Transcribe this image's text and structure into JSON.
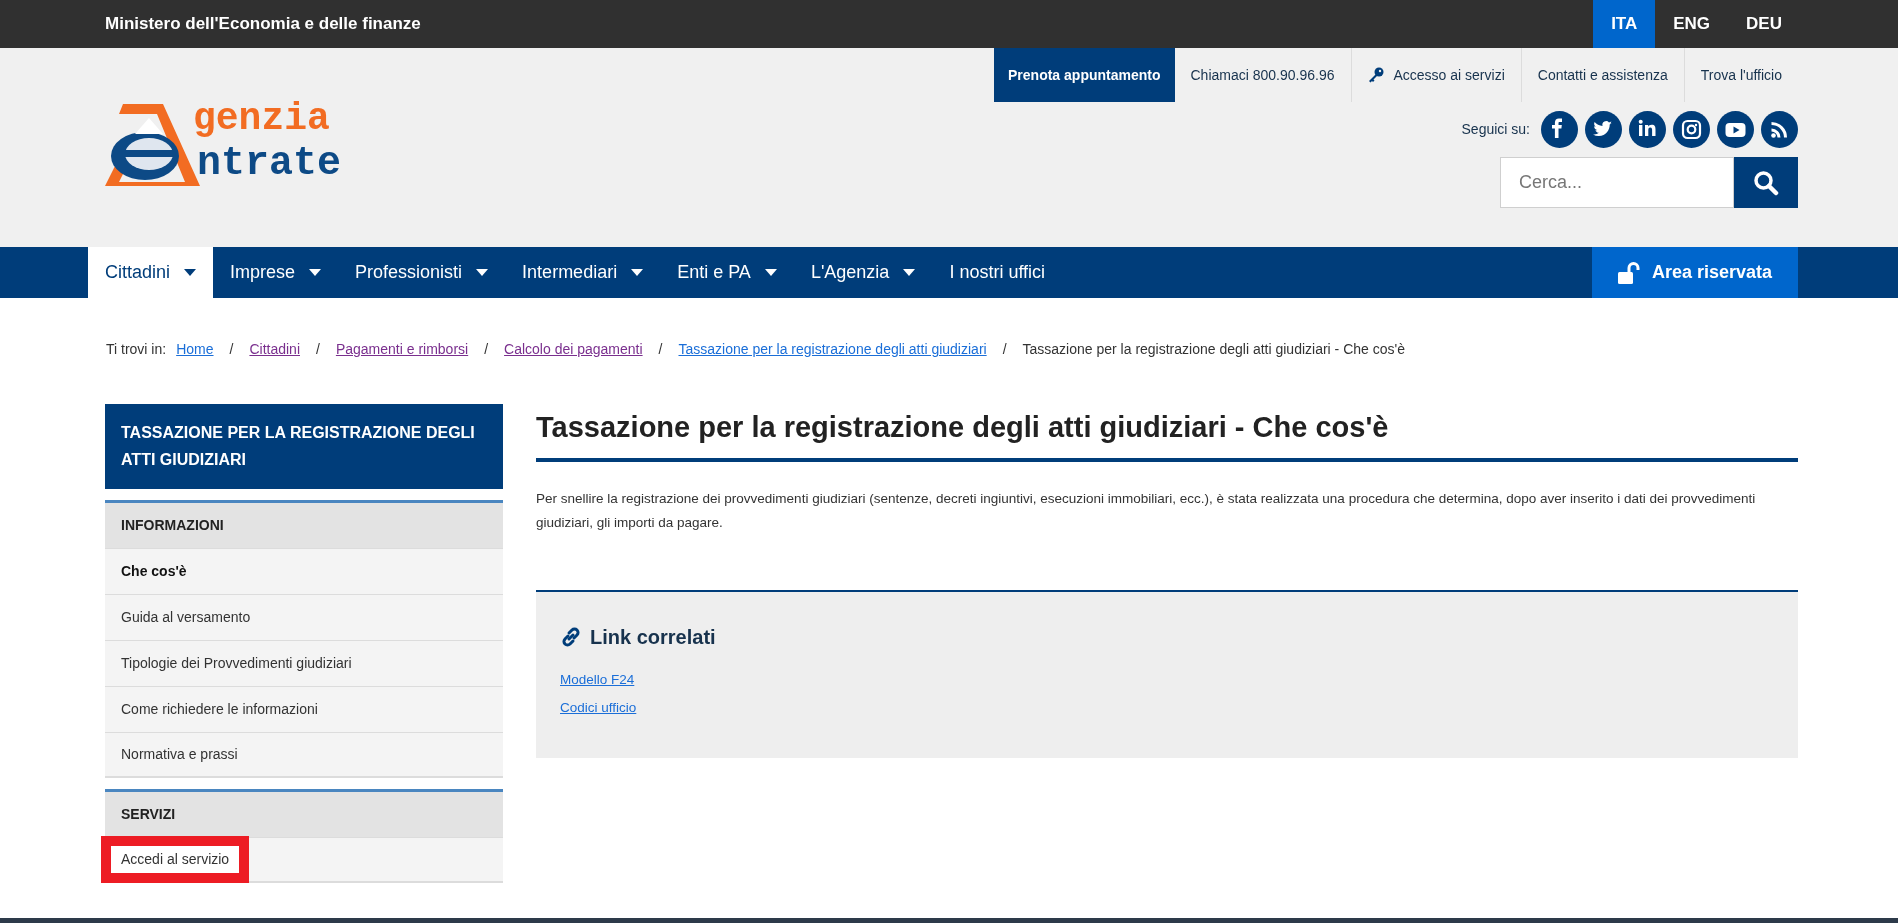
{
  "top_bar": {
    "ministry": "Ministero dell'Economia e delle finanze",
    "languages": [
      {
        "label": "ITA",
        "selected": true
      },
      {
        "label": "ENG",
        "selected": false
      },
      {
        "label": "DEU",
        "selected": false
      }
    ]
  },
  "utility_links": [
    {
      "label": "Prenota appuntamento",
      "kind": "primary"
    },
    {
      "label": "Chiamaci 800.90.96.96",
      "kind": "plain"
    },
    {
      "label": "Accesso ai servizi",
      "kind": "key"
    },
    {
      "label": "Contatti e assistenza",
      "kind": "plain"
    },
    {
      "label": "Trova l'ufficio",
      "kind": "plain"
    }
  ],
  "logo": {
    "line1": "genzia",
    "line2": "ntrate"
  },
  "social": {
    "label": "Seguici su:",
    "networks": [
      {
        "kind": "facebook"
      },
      {
        "kind": "twitter"
      },
      {
        "kind": "linkedin"
      },
      {
        "kind": "instagram"
      },
      {
        "kind": "youtube"
      },
      {
        "kind": "rss"
      }
    ]
  },
  "search": {
    "placeholder": "Cerca..."
  },
  "nav": {
    "items": [
      {
        "label": "Cittadini",
        "has_menu": true,
        "selected": true
      },
      {
        "label": "Imprese",
        "has_menu": true,
        "selected": false
      },
      {
        "label": "Professionisti",
        "has_menu": true,
        "selected": false
      },
      {
        "label": "Intermediari",
        "has_menu": true,
        "selected": false
      },
      {
        "label": "Enti e PA",
        "has_menu": true,
        "selected": false
      },
      {
        "label": "L'Agenzia",
        "has_menu": true,
        "selected": false
      },
      {
        "label": "I nostri uffici",
        "has_menu": false,
        "selected": false
      }
    ],
    "reserved_area": "Area riservata"
  },
  "breadcrumb": {
    "label": "Ti trovi in:",
    "separator": "/",
    "links": [
      {
        "label": "Home",
        "visited": false
      },
      {
        "label": "Cittadini",
        "visited": true
      },
      {
        "label": "Pagamenti e rimborsi",
        "visited": true
      },
      {
        "label": "Calcolo dei pagamenti",
        "visited": true
      },
      {
        "label": "Tassazione per la registrazione degli atti giudiziari",
        "visited": false
      }
    ],
    "current": "Tassazione per la registrazione degli atti giudiziari - Che cos'è"
  },
  "sidebar": {
    "title": "TASSAZIONE PER LA REGISTRAZIONE DEGLI ATTI GIUDIZIARI",
    "sections": [
      {
        "heading": "INFORMAZIONI",
        "items": [
          {
            "label": "Che cos'è",
            "selected": true,
            "highlighted": false
          },
          {
            "label": "Guida al versamento",
            "selected": false,
            "highlighted": false
          },
          {
            "label": "Tipologie dei Provvedimenti giudiziari",
            "selected": false,
            "highlighted": false
          },
          {
            "label": "Come richiedere le informazioni",
            "selected": false,
            "highlighted": false
          },
          {
            "label": "Normativa e prassi",
            "selected": false,
            "highlighted": false
          }
        ]
      },
      {
        "heading": "SERVIZI",
        "items": [
          {
            "label": "Accedi al servizio",
            "selected": false,
            "highlighted": true
          }
        ]
      }
    ]
  },
  "content": {
    "title": "Tassazione per la registrazione degli atti giudiziari - Che cos'è",
    "paragraph": "Per snellire la registrazione dei provvedimenti giudiziari (sentenze, decreti ingiuntivi, esecuzioni immobiliari, ecc.), è stata realizzata una procedura che determina, dopo aver inserito i dati dei provvedimenti giudiziari, gli importi da pagare.",
    "related": {
      "heading": "Link correlati",
      "links": [
        "Modello F24",
        "Codici ufficio"
      ]
    }
  }
}
